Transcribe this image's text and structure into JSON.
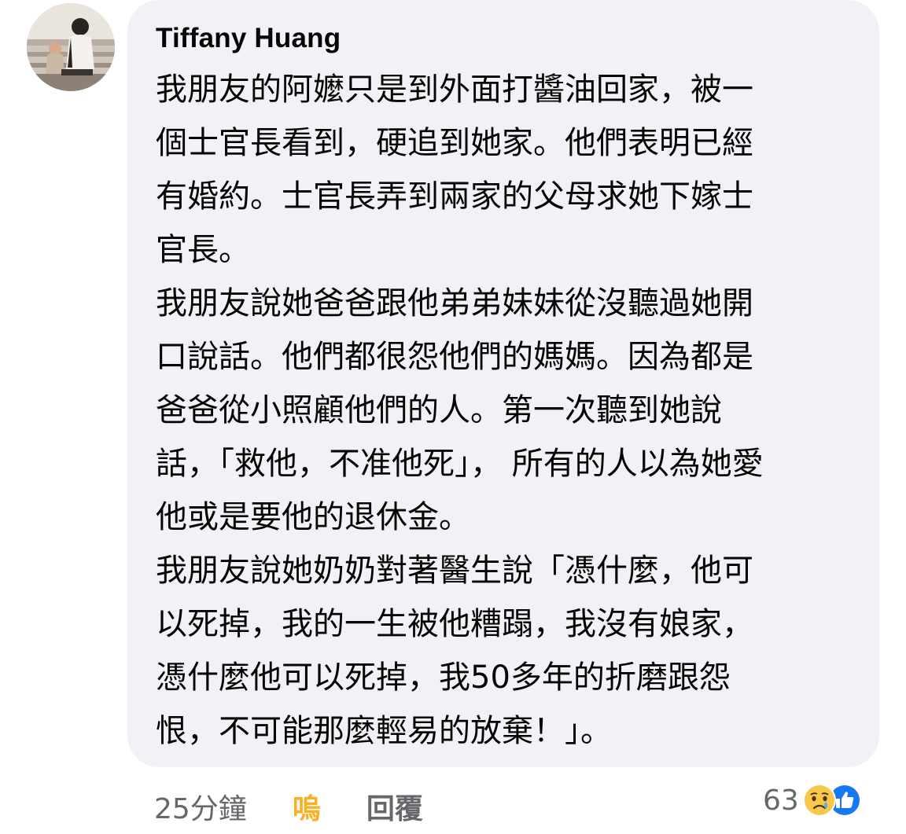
{
  "comment": {
    "author": "Tiffany Huang",
    "paragraphs": [
      [
        "我朋友的阿嬤只是到外面打醬油回家，被一",
        "個士官長看到，硬追到她家。他們表明已經",
        "有婚約。士官長弄到兩家的父母求她下嫁士",
        "官長。"
      ],
      [
        "我朋友說她爸爸跟他弟弟妹妹從沒聽過她開",
        "口說話。他們都很怨他們的媽媽。因為都是",
        "爸爸從小照顧他們的人。第一次聽到她說",
        "話，「救他，不准他死」， 所有的人以為她愛",
        "他或是要他的退休金。"
      ],
      [
        "我朋友說她奶奶對著醫生說「憑什麼，他可",
        "以死掉，我的一生被他糟蹋，我沒有娘家，",
        "憑什麼他可以死掉，我50多年的折磨跟怨",
        "恨，不可能那麼輕易的放棄！」。"
      ]
    ]
  },
  "actions": {
    "timestamp": "25分鐘",
    "react_label": "嗚",
    "reply_label": "回覆"
  },
  "reactions": {
    "count": "63",
    "icons": [
      "sad-reaction-icon",
      "like-reaction-icon"
    ]
  },
  "colors": {
    "bubble_bg": "#f0f2f5",
    "text": "#050505",
    "meta_text": "#65676b",
    "react_active": "#f7b125",
    "like_blue": "#1877f2"
  }
}
